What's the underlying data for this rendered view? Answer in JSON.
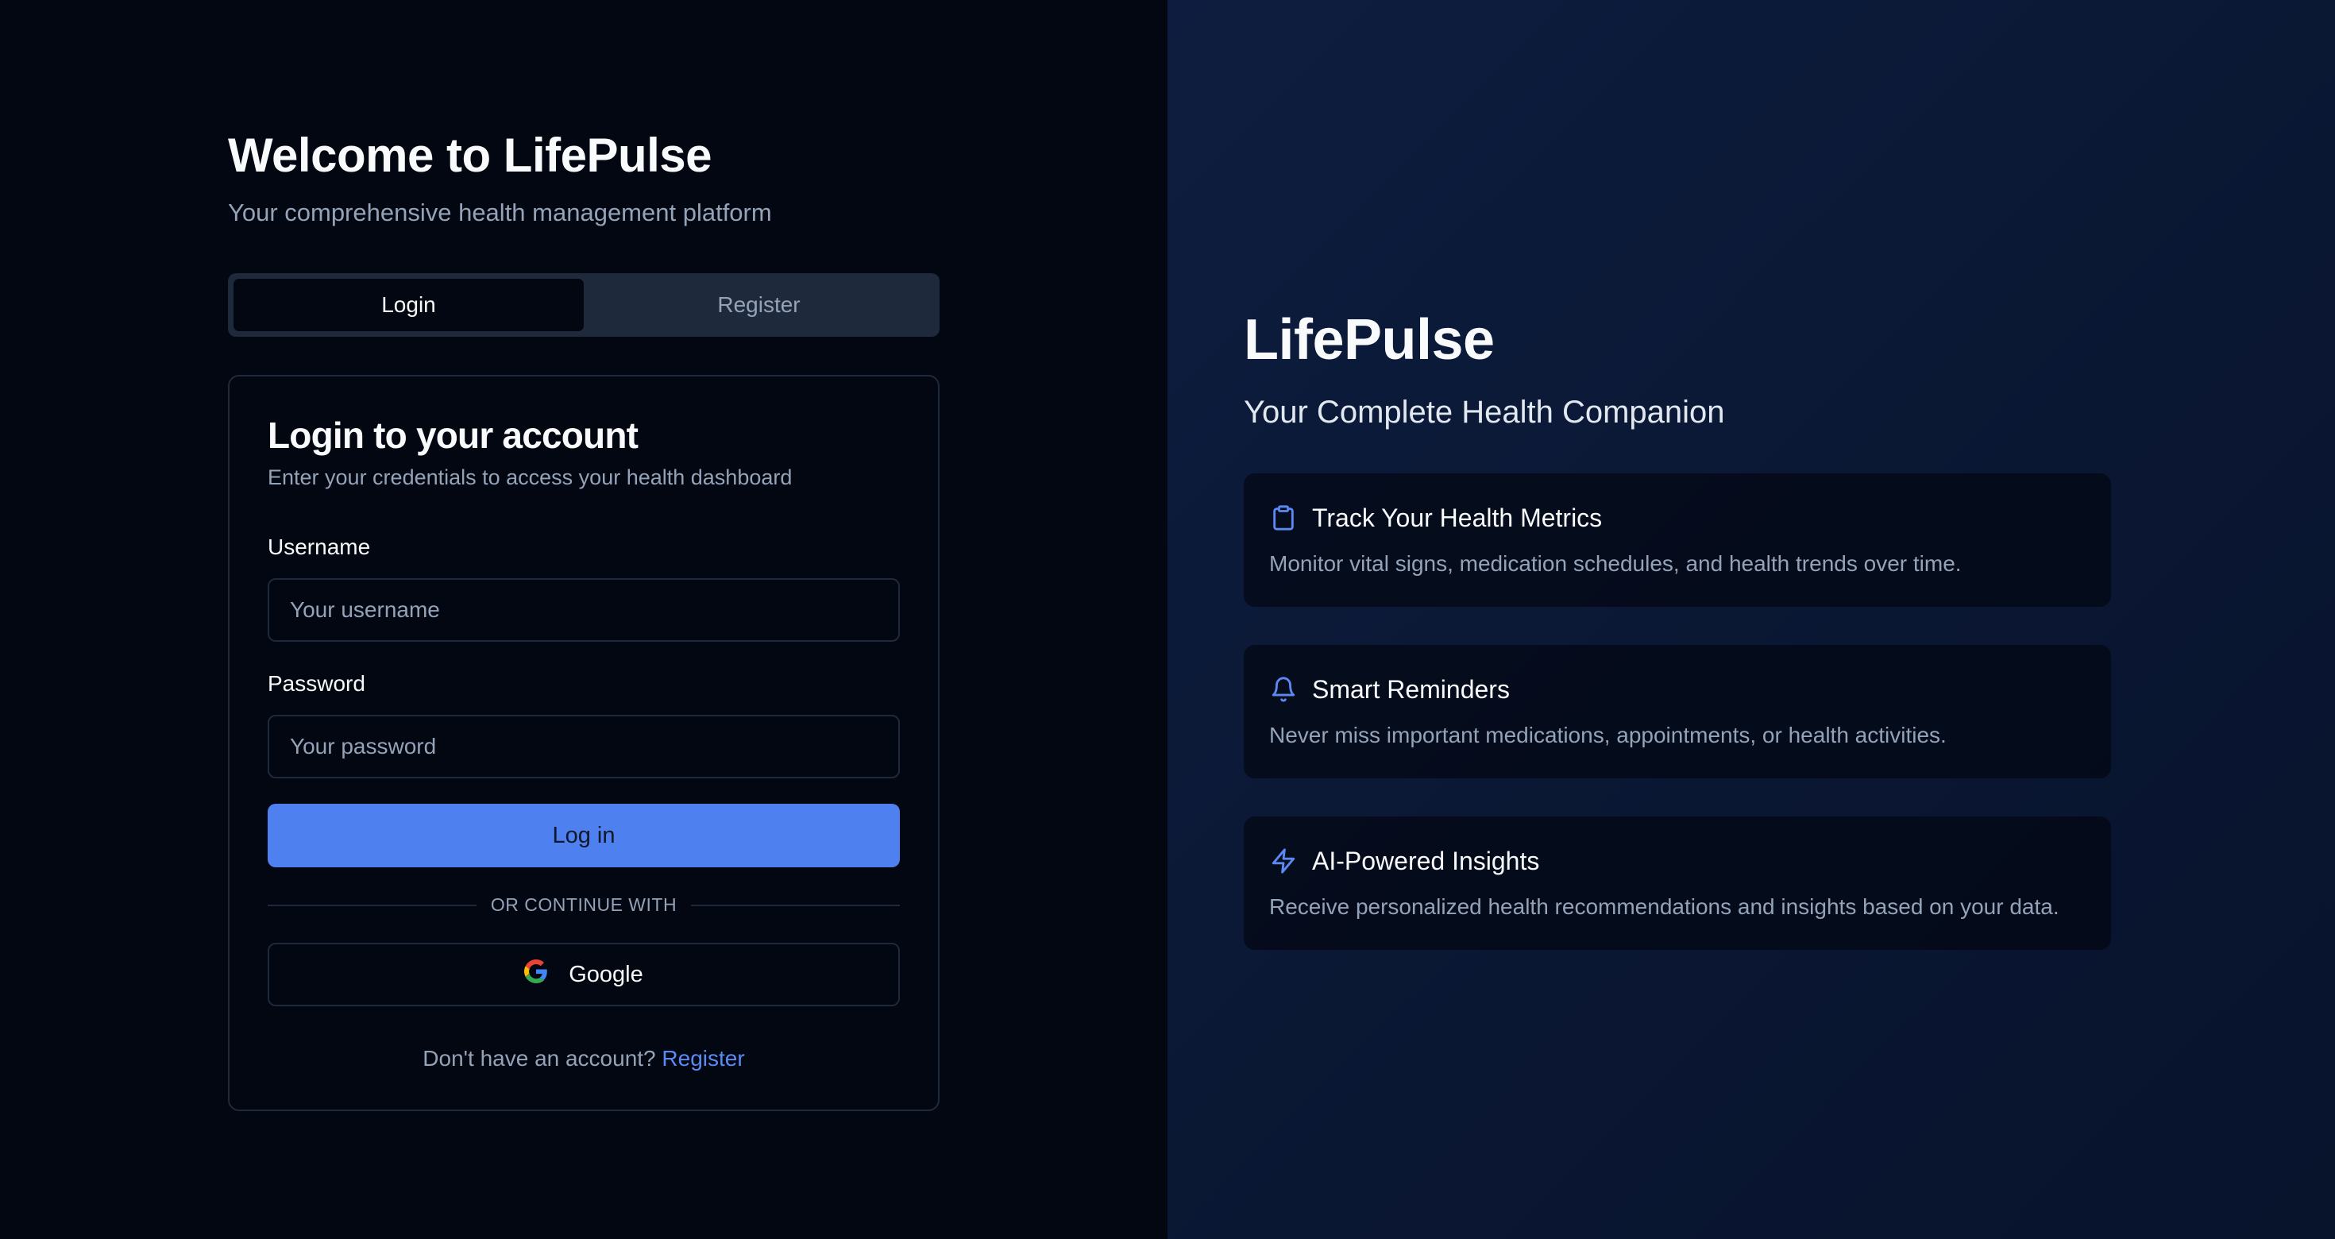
{
  "welcome": {
    "title": "Welcome to LifePulse",
    "subtitle": "Your comprehensive health management platform"
  },
  "tabs": [
    {
      "label": "Login",
      "active": true
    },
    {
      "label": "Register",
      "active": false
    }
  ],
  "login_card": {
    "title": "Login to your account",
    "subtitle": "Enter your credentials to access your health dashboard",
    "username_label": "Username",
    "username_placeholder": "Your username",
    "password_label": "Password",
    "password_placeholder": "Your password",
    "login_button": "Log in",
    "divider_text": "OR CONTINUE WITH",
    "google_button": "Google",
    "footer_prompt": "Don't have an account?",
    "footer_link": "Register"
  },
  "brand": {
    "title": "LifePulse",
    "subtitle": "Your Complete Health Companion"
  },
  "features": [
    {
      "icon": "clipboard-icon",
      "title": "Track Your Health Metrics",
      "description": "Monitor vital signs, medication schedules, and health trends over time."
    },
    {
      "icon": "bell-icon",
      "title": "Smart Reminders",
      "description": "Never miss important medications, appointments, or health activities."
    },
    {
      "icon": "lightning-icon",
      "title": "AI-Powered Insights",
      "description": "Receive personalized health recommendations and insights based on your data."
    }
  ],
  "colors": {
    "accent": "#4f80ef",
    "link": "#5b8af5",
    "background": "#030712",
    "muted_text": "#94a3b8"
  }
}
